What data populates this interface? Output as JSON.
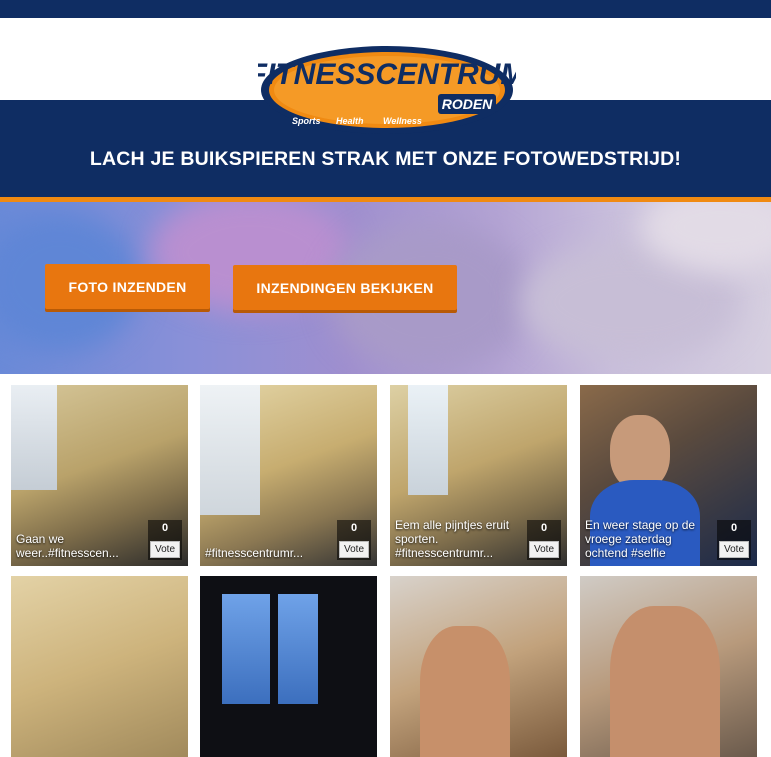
{
  "logo": {
    "name": "FITNESSCENTRUM",
    "town": "RODEN",
    "tagline_1": "Sports",
    "tagline_2": "Health",
    "tagline_3": "Wellness"
  },
  "headline": "LACH JE BUIKSPIEREN STRAK MET ONZE FOTOWEDSTRIJD!",
  "buttons": {
    "submit_photo": "FOTO INZENDEN",
    "view_entries": "INZENDINGEN BEKIJKEN"
  },
  "entries": [
    {
      "caption": "Gaan we weer..#fitnesscen...",
      "votes": "0",
      "vote_label": "Vote"
    },
    {
      "caption": "#fitnesscentrumr...",
      "votes": "0",
      "vote_label": "Vote"
    },
    {
      "caption": "Eem alle pijntjes eruit sporten. #fitnesscentrumr...",
      "votes": "0",
      "vote_label": "Vote"
    },
    {
      "caption": "En weer stage op de vroege zaterdag ochtend #selfie",
      "votes": "0",
      "vote_label": "Vote"
    }
  ],
  "colors": {
    "navy": "#0f2d63",
    "orange": "#e8760f"
  }
}
